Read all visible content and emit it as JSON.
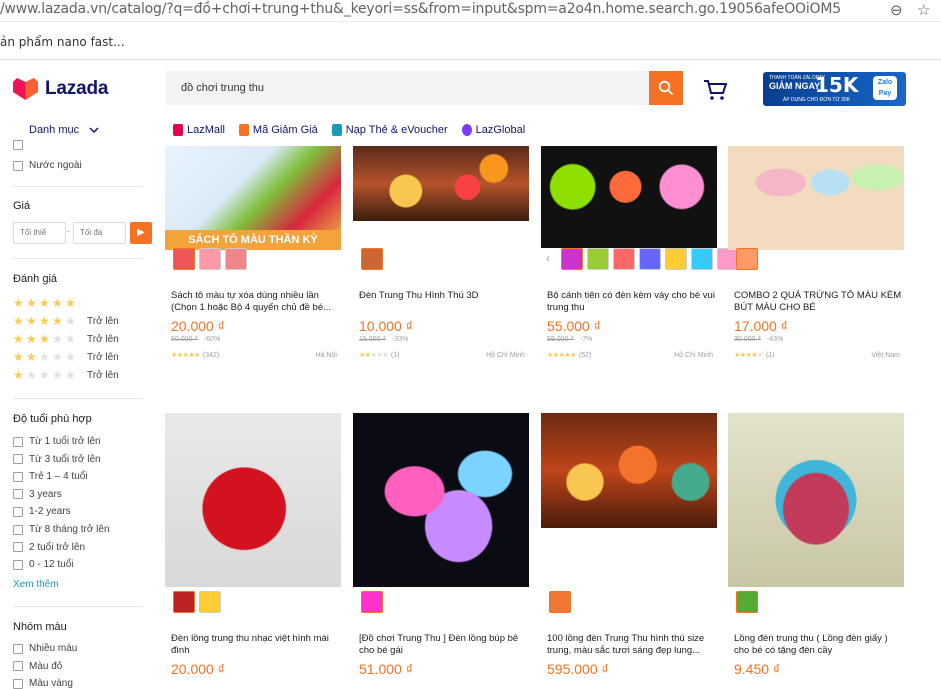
{
  "browser": {
    "url": "/www.lazada.vn/catalog/?q=đồ+chơi+trung+thu&_keyori=ss&from=input&spm=a2o4n.home.search.go.19056afeOOiOM5",
    "bookmark": "ản phẩm nano fast..."
  },
  "header": {
    "logo": "Lazada",
    "search_value": "đồ chơi trung thu",
    "promo": {
      "line1": "THANH TOÁN ZALOPAY",
      "line2": "GIẢM NGAY",
      "amount": "15K",
      "note": "ÁP DỤNG CHO ĐƠN TỪ 30K",
      "brand": "Zalo Pay"
    },
    "category_menu": "Danh mục",
    "nav": [
      {
        "label": "LazMall",
        "color": "#e4004f"
      },
      {
        "label": "Mã Giảm Giá",
        "color": "#f57224"
      },
      {
        "label": "Nạp Thẻ & eVoucher",
        "color": "#1a9cb7"
      },
      {
        "label": "LazGlobal",
        "color": "#7d3cf8"
      }
    ]
  },
  "sidebar": {
    "top_item": "Nước ngoài",
    "price_title": "Giá",
    "price_min_placeholder": "Tối thiể",
    "price_max_placeholder": "Tối đa",
    "price_sep": "-",
    "rating_title": "Đánh giá",
    "rating_suffix": "Trở lên",
    "age_title": "Độ tuổi phù hợp",
    "ages": [
      "Từ 1 tuổi trở lên",
      "Từ 3 tuổi trở lên",
      "Trẻ 1 – 4 tuổi",
      "3 years",
      "1-2 years",
      "Từ 8 tháng trở lên",
      "2 tuổi trở lên",
      "0 - 12 tuổi"
    ],
    "see_more": "Xem thêm",
    "color_title": "Nhóm màu",
    "colors": [
      "Nhiều màu",
      "Màu đỏ",
      "Màu vàng"
    ]
  },
  "products": [
    {
      "title": "Sách tô màu tự xóa dùng nhiều lần (Chọn 1 hoặc Bộ 4 quyển chủ đề bé...",
      "price": "20.000 ₫",
      "original": "50.000 ₫",
      "discount": "-60%",
      "stars": 5,
      "reviews": "(342)",
      "location": "Hà Nội",
      "banner": "SÁCH TÔ MÀU THẦN KỲ"
    },
    {
      "title": "Đèn Trung Thu Hình Thú 3D",
      "price": "10.000 ₫",
      "original": "15.000 ₫",
      "discount": "-33%",
      "stars": 2,
      "reviews": "(1)",
      "location": "Hồ Chí Minh"
    },
    {
      "title": "Bộ cánh tiên có đèn kèm váy cho bé vui trung thu",
      "price": "55.000 ₫",
      "original": "59.000 ₫",
      "discount": "-7%",
      "stars": 5,
      "reviews": "(52)",
      "location": "Hồ Chí Minh"
    },
    {
      "title": "COMBO 2 QUẢ TRỨNG TÔ MÀU KÈM BÚT MÀU CHO BÉ",
      "price": "17.000 ₫",
      "original": "30.000 ₫",
      "discount": "-43%",
      "stars": 4,
      "reviews": "(1)",
      "location": "Việt Nam"
    },
    {
      "title": "Đèn lồng trung thu nhạc việt hình mái đình",
      "price": "20.000 ₫"
    },
    {
      "title": "[Đồ chơi Trung Thu ] Đèn lồng búp bê cho bé gái",
      "price": "51.000 ₫"
    },
    {
      "title": "100 lồng đèn Trung Thu hình thú size trung, màu sắc tươi sáng đẹp lung...",
      "price": "595.000 ₫"
    },
    {
      "title": "Lồng đèn trung thu ( Lồng đèn giấy ) cho bé có tặng đèn cầy",
      "price": "9.450 ₫"
    }
  ]
}
